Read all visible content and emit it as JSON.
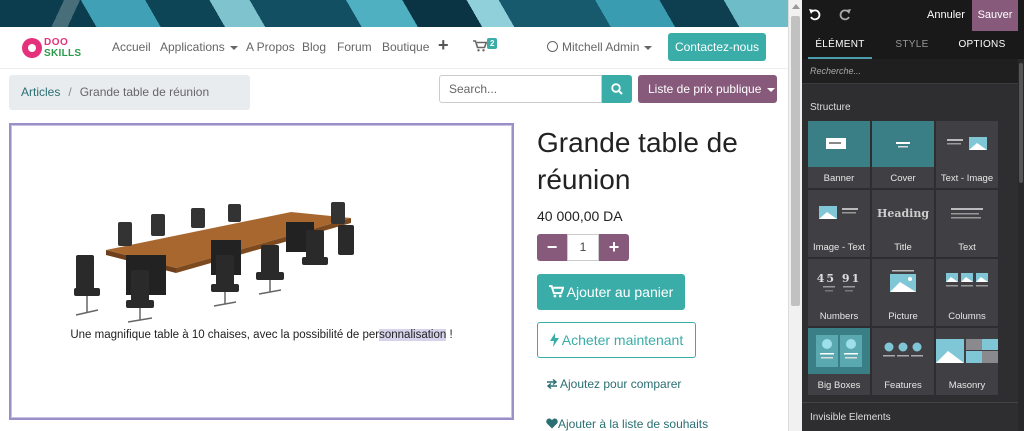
{
  "navbar": {
    "logo_top": "DOO",
    "logo_bottom": "SKILLS",
    "items": [
      "Accueil",
      "Applications",
      "A Propos",
      "Blog",
      "Forum",
      "Boutique"
    ],
    "cart_count": "2",
    "user": "Mitchell Admin",
    "contact_label": "Contactez-nous"
  },
  "breadcrumb": {
    "parent": "Articles",
    "separator": "/",
    "current": "Grande table de réunion"
  },
  "search": {
    "placeholder": "Search..."
  },
  "pricelist": {
    "label": "Liste de prix publique"
  },
  "product": {
    "title": "Grande table de réunion",
    "price": "40 000,00 DA",
    "quantity": "1",
    "caption_before": "Une magnifique table à 10 chaises, avec la possibilité de per",
    "caption_highlight": "sonnalisation",
    "caption_after": " !",
    "add_to_cart": "Ajouter au panier",
    "buy_now": "Acheter maintenant",
    "compare": "Ajoutez pour comparer",
    "wishlist": "Ajouter à la liste de souhaits"
  },
  "editor": {
    "cancel_label": "Annuler",
    "save_label": "Sauver",
    "tabs": [
      "ÉLÉMENT",
      "STYLE",
      "OPTIONS"
    ],
    "active_tab": "ÉLÉMENT",
    "search_placeholder": "Recherche...",
    "structure_title": "Structure",
    "blocks": [
      "Banner",
      "Cover",
      "Text - Image",
      "Image - Text",
      "Title",
      "Text",
      "Numbers",
      "Picture",
      "Columns",
      "Big Boxes",
      "Features",
      "Masonry"
    ],
    "title_block_word": "Heading",
    "numbers_block_values": [
      "45",
      "91"
    ],
    "invisible_title": "Invisible Elements"
  },
  "colors": {
    "primary": "#3aada8",
    "secondary": "#875a7b",
    "editor_bg": "#2e2e30"
  }
}
